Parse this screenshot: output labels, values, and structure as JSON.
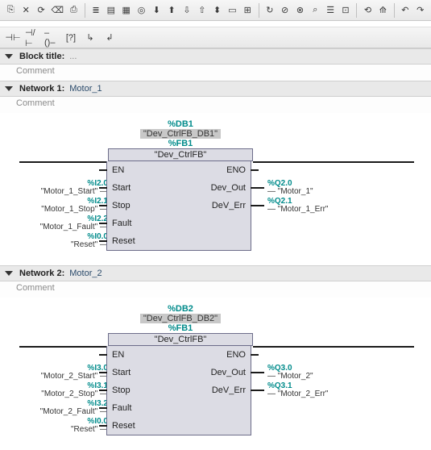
{
  "block_title_label": "Block title:",
  "block_title_value": "...",
  "comment_label": "Comment",
  "networks": [
    {
      "header": "Network 1:",
      "title": "Motor_1",
      "comment": "Comment",
      "db_addr": "%DB1",
      "db_name": "\"Dev_CtrlFB_DB1\"",
      "fb_addr": "%FB1",
      "fb_name": "\"Dev_CtrlFB\"",
      "ports_left": [
        "EN",
        "Start",
        "Stop",
        "Fault",
        "Reset"
      ],
      "ports_right": [
        "ENO",
        "Dev_Out",
        "DeV_Err"
      ],
      "sig_left": [
        {
          "addr": "%I2.0",
          "name": "\"Motor_1_Start\""
        },
        {
          "addr": "%I2.1",
          "name": "\"Motor_1_Stop\""
        },
        {
          "addr": "%I2.2",
          "name": "\"Motor_1_Fault\""
        },
        {
          "addr": "%I0.0",
          "name": "\"Reset\""
        }
      ],
      "sig_right": [
        {
          "addr": "%Q2.0",
          "name": "\"Motor_1\""
        },
        {
          "addr": "%Q2.1",
          "name": "\"Motor_1_Err\""
        }
      ]
    },
    {
      "header": "Network 2:",
      "title": "Motor_2",
      "comment": "Comment",
      "db_addr": "%DB2",
      "db_name": "\"Dev_CtrlFB_DB2\"",
      "fb_addr": "%FB1",
      "fb_name": "\"Dev_CtrlFB\"",
      "ports_left": [
        "EN",
        "Start",
        "Stop",
        "Fault",
        "Reset"
      ],
      "ports_right": [
        "ENO",
        "Dev_Out",
        "DeV_Err"
      ],
      "sig_left": [
        {
          "addr": "%I3.0",
          "name": "\"Motor_2_Start\""
        },
        {
          "addr": "%I3.1",
          "name": "\"Motor_2_Stop\""
        },
        {
          "addr": "%I3.2",
          "name": "\"Motor_2_Fault\""
        },
        {
          "addr": "%I0.0",
          "name": "\"Reset\""
        }
      ],
      "sig_right": [
        {
          "addr": "%Q3.0",
          "name": "\"Motor_2\""
        },
        {
          "addr": "%Q3.1",
          "name": "\"Motor_2_Err\""
        }
      ]
    }
  ]
}
